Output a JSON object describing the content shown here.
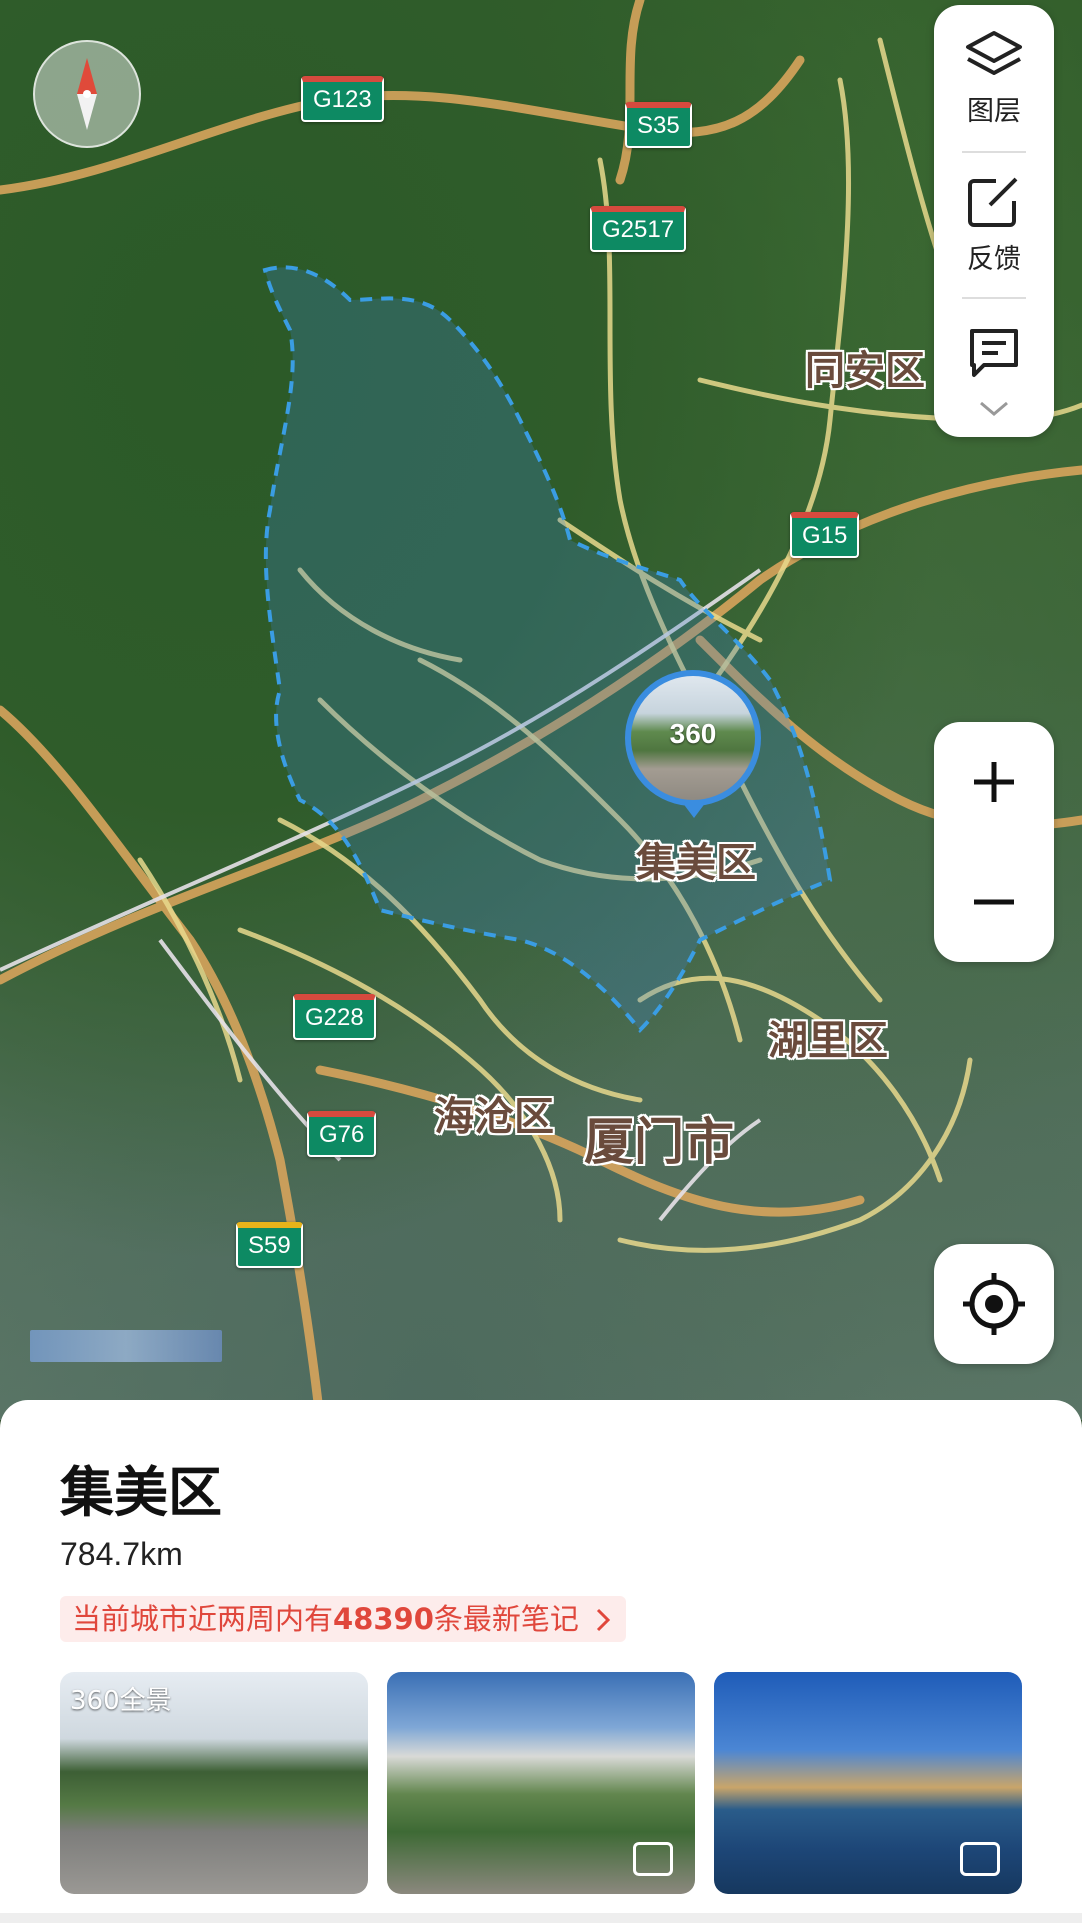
{
  "map": {
    "compass_icon": "compass-icon",
    "highways": [
      "G123",
      "S35",
      "G2517",
      "G15",
      "G228",
      "G76",
      "S59"
    ],
    "districts": {
      "tongan": "同安区",
      "jimei": "集美区",
      "huli": "湖里区",
      "haicang": "海沧区",
      "xiamen": "厦门市"
    },
    "pano_label": "360"
  },
  "toolbar": {
    "layers_label": "图层",
    "feedback_label": "反馈",
    "notes_icon": "message-icon",
    "expand_icon": "chevron-down-icon"
  },
  "zoom": {
    "in": "+",
    "out": "−"
  },
  "sheet": {
    "title": "集美区",
    "distance": "784.7km",
    "notes_prefix": "当前城市近两周内有",
    "notes_count": "48390",
    "notes_suffix": "条最新笔记",
    "photo_badge": "360全景"
  },
  "colors": {
    "highway": "#0d8a63",
    "boundary": "#3a9de3",
    "accent": "#e0473c"
  }
}
